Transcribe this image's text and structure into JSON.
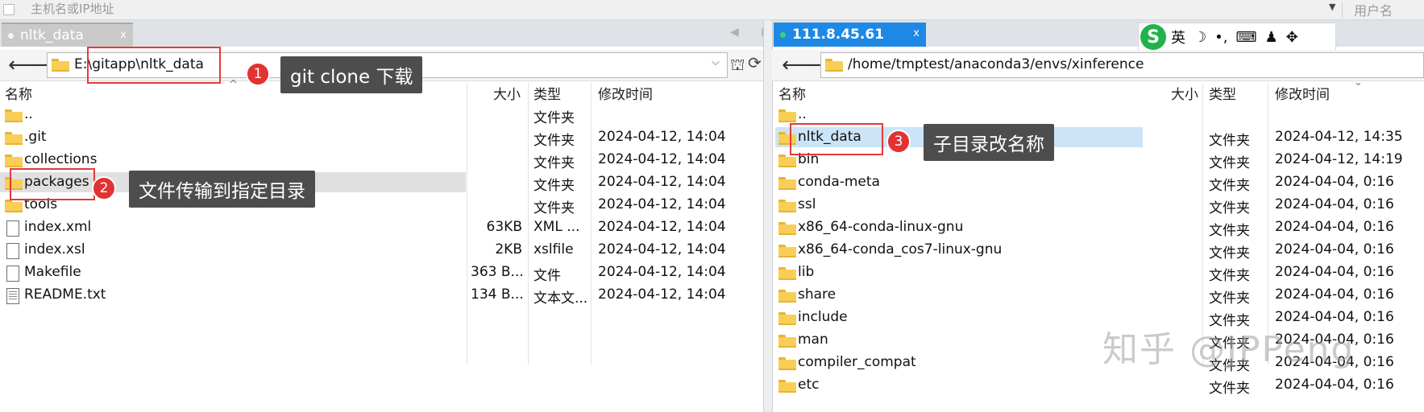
{
  "topbar": {
    "host_placeholder": "主机名或IP地址",
    "user_placeholder": "用户名"
  },
  "left": {
    "tab": {
      "label": "nltk_data",
      "close": "x"
    },
    "path": "E:\\gitapp\\nltk_data",
    "columns": {
      "name": "名称",
      "size": "大小",
      "type": "类型",
      "modified": "修改时间"
    },
    "files": [
      {
        "name": "..",
        "size": "",
        "type": "文件夹",
        "modified": "",
        "icon": "folder"
      },
      {
        "name": ".git",
        "size": "",
        "type": "文件夹",
        "modified": "2024-04-12, 14:04",
        "icon": "folder"
      },
      {
        "name": "collections",
        "size": "",
        "type": "文件夹",
        "modified": "2024-04-12, 14:04",
        "icon": "folder"
      },
      {
        "name": "packages",
        "size": "",
        "type": "文件夹",
        "modified": "2024-04-12, 14:04",
        "icon": "folder"
      },
      {
        "name": "tools",
        "size": "",
        "type": "文件夹",
        "modified": "2024-04-12, 14:04",
        "icon": "folder"
      },
      {
        "name": "index.xml",
        "size": "63KB",
        "type": "XML ...",
        "modified": "2024-04-12, 14:04",
        "icon": "file"
      },
      {
        "name": "index.xsl",
        "size": "2KB",
        "type": "xslfile",
        "modified": "2024-04-12, 14:04",
        "icon": "file"
      },
      {
        "name": "Makefile",
        "size": "363 B...",
        "type": "文件",
        "modified": "2024-04-12, 14:04",
        "icon": "file"
      },
      {
        "name": "README.txt",
        "size": "134 B...",
        "type": "文本文...",
        "modified": "2024-04-12, 14:04",
        "icon": "text-file"
      }
    ]
  },
  "right": {
    "tab": {
      "label": "111.8.45.61",
      "close": "x"
    },
    "path": "/home/tmptest/anaconda3/envs/xinference",
    "columns": {
      "name": "名称",
      "size": "大小",
      "type": "类型",
      "modified": "修改时间"
    },
    "files": [
      {
        "name": "..",
        "type": "",
        "modified": ""
      },
      {
        "name": "nltk_data",
        "type": "文件夹",
        "modified": "2024-04-12, 14:35"
      },
      {
        "name": "bin",
        "type": "文件夹",
        "modified": "2024-04-12, 14:19"
      },
      {
        "name": "conda-meta",
        "type": "文件夹",
        "modified": "2024-04-04, 0:16"
      },
      {
        "name": "ssl",
        "type": "文件夹",
        "modified": "2024-04-04, 0:16"
      },
      {
        "name": "x86_64-conda-linux-gnu",
        "type": "文件夹",
        "modified": "2024-04-04, 0:16"
      },
      {
        "name": "x86_64-conda_cos7-linux-gnu",
        "type": "文件夹",
        "modified": "2024-04-04, 0:16"
      },
      {
        "name": "lib",
        "type": "文件夹",
        "modified": "2024-04-04, 0:16"
      },
      {
        "name": "share",
        "type": "文件夹",
        "modified": "2024-04-04, 0:16"
      },
      {
        "name": "include",
        "type": "文件夹",
        "modified": "2024-04-04, 0:16"
      },
      {
        "name": "man",
        "type": "文件夹",
        "modified": "2024-04-04, 0:16"
      },
      {
        "name": "compiler_compat",
        "type": "文件夹",
        "modified": "2024-04-04, 0:16"
      },
      {
        "name": "etc",
        "type": "文件夹",
        "modified": "2024-04-04, 0:16"
      }
    ]
  },
  "ime": {
    "logo": "S",
    "lang": "英"
  },
  "annotations": [
    {
      "number": "1",
      "text": "git clone 下载"
    },
    {
      "number": "2",
      "text": "文件传输到指定目录"
    },
    {
      "number": "3",
      "text": "子目录改名称"
    }
  ],
  "watermark": "知乎 @JPPeng",
  "colors": {
    "accent": "#1e88e5",
    "annotation_red": "#e23232",
    "callout_bg": "#4d4d4d",
    "folder": "#f8ce57",
    "selection": "#cce4f7"
  }
}
